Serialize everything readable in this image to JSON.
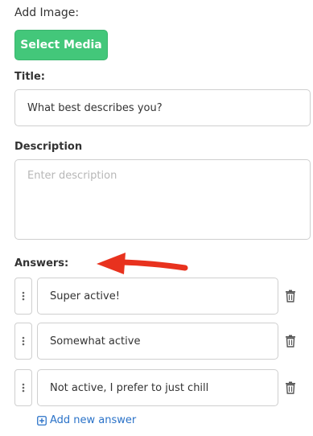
{
  "add_image": {
    "label": "Add Image:",
    "button_label": "Select Media"
  },
  "title": {
    "label": "Title:",
    "value": "What best describes you?"
  },
  "description": {
    "label": "Description",
    "placeholder": "Enter description"
  },
  "answers": {
    "label": "Answers:",
    "items": [
      {
        "label": "Super active!"
      },
      {
        "label": "Somewhat active"
      },
      {
        "label": "Not active, I prefer to just chill"
      }
    ],
    "add_label": "Add new answer"
  },
  "icons": {
    "drag_handle": "vertical-dots-icon",
    "delete": "trash-icon",
    "add": "plus-square-icon",
    "annotation": "red-arrow-icon"
  },
  "colors": {
    "primary_button": "#43c77a",
    "link": "#2a72c8",
    "annotation_arrow": "#e8321e"
  }
}
